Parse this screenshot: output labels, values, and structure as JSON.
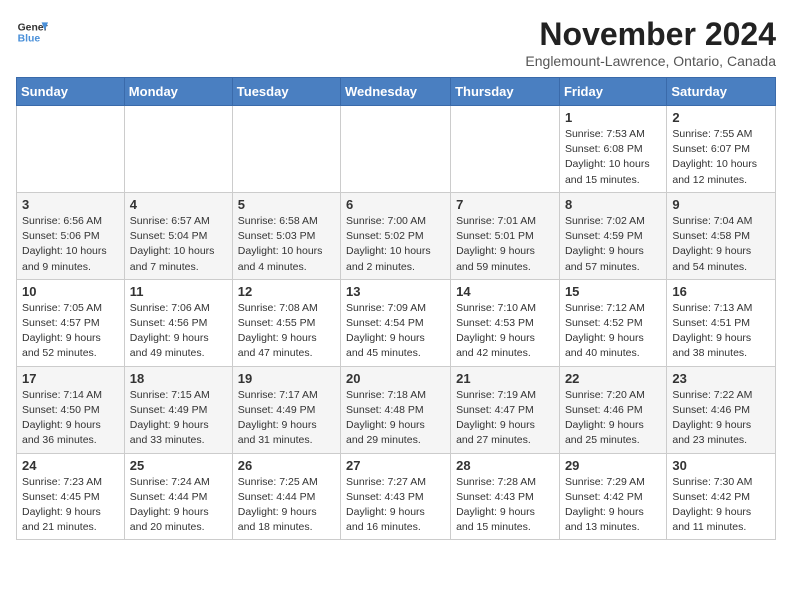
{
  "logo": {
    "line1": "General",
    "line2": "Blue"
  },
  "title": "November 2024",
  "location": "Englemount-Lawrence, Ontario, Canada",
  "weekdays": [
    "Sunday",
    "Monday",
    "Tuesday",
    "Wednesday",
    "Thursday",
    "Friday",
    "Saturday"
  ],
  "weeks": [
    [
      {
        "day": "",
        "info": ""
      },
      {
        "day": "",
        "info": ""
      },
      {
        "day": "",
        "info": ""
      },
      {
        "day": "",
        "info": ""
      },
      {
        "day": "",
        "info": ""
      },
      {
        "day": "1",
        "info": "Sunrise: 7:53 AM\nSunset: 6:08 PM\nDaylight: 10 hours and 15 minutes."
      },
      {
        "day": "2",
        "info": "Sunrise: 7:55 AM\nSunset: 6:07 PM\nDaylight: 10 hours and 12 minutes."
      }
    ],
    [
      {
        "day": "3",
        "info": "Sunrise: 6:56 AM\nSunset: 5:06 PM\nDaylight: 10 hours and 9 minutes."
      },
      {
        "day": "4",
        "info": "Sunrise: 6:57 AM\nSunset: 5:04 PM\nDaylight: 10 hours and 7 minutes."
      },
      {
        "day": "5",
        "info": "Sunrise: 6:58 AM\nSunset: 5:03 PM\nDaylight: 10 hours and 4 minutes."
      },
      {
        "day": "6",
        "info": "Sunrise: 7:00 AM\nSunset: 5:02 PM\nDaylight: 10 hours and 2 minutes."
      },
      {
        "day": "7",
        "info": "Sunrise: 7:01 AM\nSunset: 5:01 PM\nDaylight: 9 hours and 59 minutes."
      },
      {
        "day": "8",
        "info": "Sunrise: 7:02 AM\nSunset: 4:59 PM\nDaylight: 9 hours and 57 minutes."
      },
      {
        "day": "9",
        "info": "Sunrise: 7:04 AM\nSunset: 4:58 PM\nDaylight: 9 hours and 54 minutes."
      }
    ],
    [
      {
        "day": "10",
        "info": "Sunrise: 7:05 AM\nSunset: 4:57 PM\nDaylight: 9 hours and 52 minutes."
      },
      {
        "day": "11",
        "info": "Sunrise: 7:06 AM\nSunset: 4:56 PM\nDaylight: 9 hours and 49 minutes."
      },
      {
        "day": "12",
        "info": "Sunrise: 7:08 AM\nSunset: 4:55 PM\nDaylight: 9 hours and 47 minutes."
      },
      {
        "day": "13",
        "info": "Sunrise: 7:09 AM\nSunset: 4:54 PM\nDaylight: 9 hours and 45 minutes."
      },
      {
        "day": "14",
        "info": "Sunrise: 7:10 AM\nSunset: 4:53 PM\nDaylight: 9 hours and 42 minutes."
      },
      {
        "day": "15",
        "info": "Sunrise: 7:12 AM\nSunset: 4:52 PM\nDaylight: 9 hours and 40 minutes."
      },
      {
        "day": "16",
        "info": "Sunrise: 7:13 AM\nSunset: 4:51 PM\nDaylight: 9 hours and 38 minutes."
      }
    ],
    [
      {
        "day": "17",
        "info": "Sunrise: 7:14 AM\nSunset: 4:50 PM\nDaylight: 9 hours and 36 minutes."
      },
      {
        "day": "18",
        "info": "Sunrise: 7:15 AM\nSunset: 4:49 PM\nDaylight: 9 hours and 33 minutes."
      },
      {
        "day": "19",
        "info": "Sunrise: 7:17 AM\nSunset: 4:49 PM\nDaylight: 9 hours and 31 minutes."
      },
      {
        "day": "20",
        "info": "Sunrise: 7:18 AM\nSunset: 4:48 PM\nDaylight: 9 hours and 29 minutes."
      },
      {
        "day": "21",
        "info": "Sunrise: 7:19 AM\nSunset: 4:47 PM\nDaylight: 9 hours and 27 minutes."
      },
      {
        "day": "22",
        "info": "Sunrise: 7:20 AM\nSunset: 4:46 PM\nDaylight: 9 hours and 25 minutes."
      },
      {
        "day": "23",
        "info": "Sunrise: 7:22 AM\nSunset: 4:46 PM\nDaylight: 9 hours and 23 minutes."
      }
    ],
    [
      {
        "day": "24",
        "info": "Sunrise: 7:23 AM\nSunset: 4:45 PM\nDaylight: 9 hours and 21 minutes."
      },
      {
        "day": "25",
        "info": "Sunrise: 7:24 AM\nSunset: 4:44 PM\nDaylight: 9 hours and 20 minutes."
      },
      {
        "day": "26",
        "info": "Sunrise: 7:25 AM\nSunset: 4:44 PM\nDaylight: 9 hours and 18 minutes."
      },
      {
        "day": "27",
        "info": "Sunrise: 7:27 AM\nSunset: 4:43 PM\nDaylight: 9 hours and 16 minutes."
      },
      {
        "day": "28",
        "info": "Sunrise: 7:28 AM\nSunset: 4:43 PM\nDaylight: 9 hours and 15 minutes."
      },
      {
        "day": "29",
        "info": "Sunrise: 7:29 AM\nSunset: 4:42 PM\nDaylight: 9 hours and 13 minutes."
      },
      {
        "day": "30",
        "info": "Sunrise: 7:30 AM\nSunset: 4:42 PM\nDaylight: 9 hours and 11 minutes."
      }
    ]
  ]
}
